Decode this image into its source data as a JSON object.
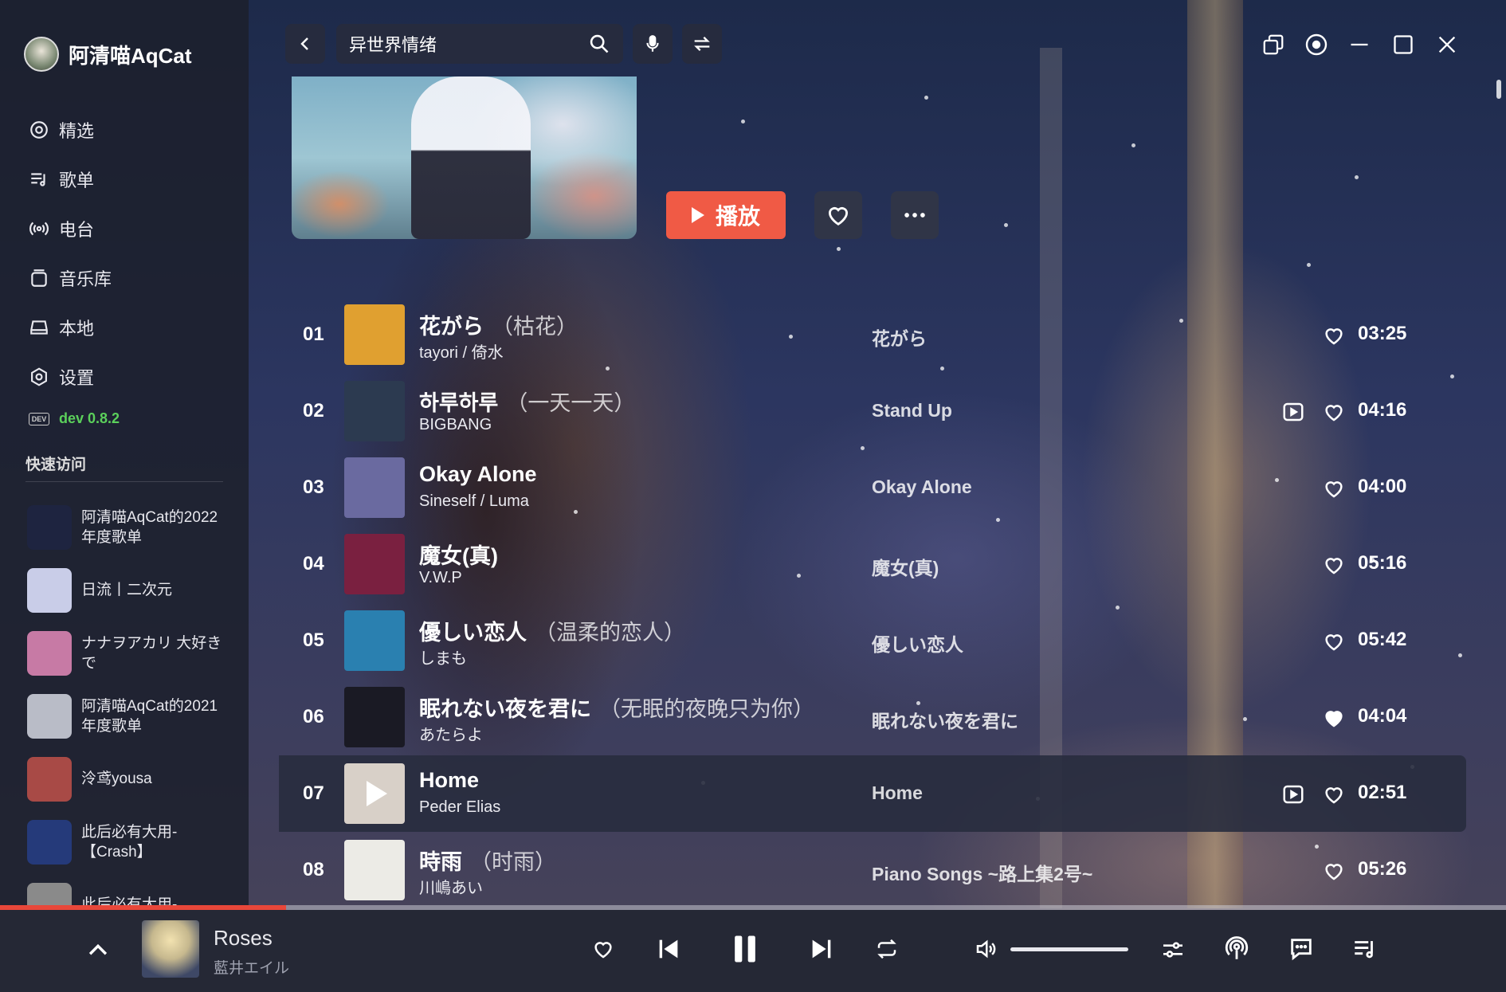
{
  "app": {
    "name": "阿清喵AqCat"
  },
  "sidebar": {
    "nav": [
      {
        "label": "精选",
        "icon": "compass-icon"
      },
      {
        "label": "歌单",
        "icon": "playlist-icon"
      },
      {
        "label": "电台",
        "icon": "radio-icon"
      },
      {
        "label": "音乐库",
        "icon": "library-icon"
      },
      {
        "label": "本地",
        "icon": "local-drive-icon"
      },
      {
        "label": "设置",
        "icon": "gear-icon"
      }
    ],
    "dev_badge": "DEV",
    "version": "dev 0.8.2",
    "quick_access_title": "快速访问",
    "quick_access": [
      {
        "label": "阿清喵AqCat的2022年度歌单",
        "color": "#1e2440"
      },
      {
        "label": "日流丨二次元",
        "color": "#c9cde8"
      },
      {
        "label": "ナナヲアカリ 大好きで",
        "color": "#c77aa5"
      },
      {
        "label": "阿清喵AqCat的2021年度歌单",
        "color": "#b9bcc7"
      },
      {
        "label": "泠鸢yousa",
        "color": "#a84a46"
      },
      {
        "label": "此后必有大用-【Crash】",
        "color": "#253a7a"
      },
      {
        "label": "此后必有大用-",
        "color": "#8a8a8a"
      }
    ]
  },
  "topbar": {
    "search_value": "异世界情绪"
  },
  "playlist": {
    "play_label": "播放"
  },
  "tracks": [
    {
      "num": "01",
      "title": "花がら",
      "alias": "（枯花）",
      "artist": "tayori / 倚水",
      "album": "花がら",
      "duration": "03:25",
      "mv": false,
      "liked": false,
      "active": false,
      "thumb": "#e0a030"
    },
    {
      "num": "02",
      "title": "하루하루",
      "alias": "（一天一天）",
      "artist": "BIGBANG",
      "album": "Stand Up",
      "duration": "04:16",
      "mv": true,
      "liked": false,
      "active": false,
      "thumb": "#2c3a50"
    },
    {
      "num": "03",
      "title": "Okay Alone",
      "alias": "",
      "artist": "Sineself / Luma",
      "album": "Okay Alone",
      "duration": "04:00",
      "mv": false,
      "liked": false,
      "active": false,
      "thumb": "#6a6aa0"
    },
    {
      "num": "04",
      "title": "魔女(真)",
      "alias": "",
      "artist": "V.W.P",
      "album": "魔女(真)",
      "duration": "05:16",
      "mv": false,
      "liked": false,
      "active": false,
      "thumb": "#7a2040"
    },
    {
      "num": "05",
      "title": "優しい恋人",
      "alias": "（温柔的恋人）",
      "artist": "しまも",
      "album": "優しい恋人",
      "duration": "05:42",
      "mv": false,
      "liked": false,
      "active": false,
      "thumb": "#2a80b0"
    },
    {
      "num": "06",
      "title": "眠れない夜を君に",
      "alias": "（无眠的夜晚只为你）",
      "artist": "あたらよ",
      "album": "眠れない夜を君に",
      "duration": "04:04",
      "mv": false,
      "liked": true,
      "active": false,
      "thumb": "#1a1a24"
    },
    {
      "num": "07",
      "title": "Home",
      "alias": "",
      "artist": "Peder Elias",
      "album": "Home",
      "duration": "02:51",
      "mv": true,
      "liked": false,
      "active": true,
      "thumb": "#d8d0c8"
    },
    {
      "num": "08",
      "title": "時雨",
      "alias": "（时雨）",
      "artist": "川嶋あい",
      "album": "Piano Songs ~路上集2号~",
      "duration": "05:26",
      "mv": false,
      "liked": false,
      "active": false,
      "thumb": "#ecebe6"
    }
  ],
  "player": {
    "title": "Roses",
    "artist": "藍井エイル",
    "progress": 0.19,
    "volume": 1.0
  },
  "colors": {
    "accent": "#f05a45",
    "progress": "#e8473a",
    "dev_green": "#5bd05b"
  }
}
